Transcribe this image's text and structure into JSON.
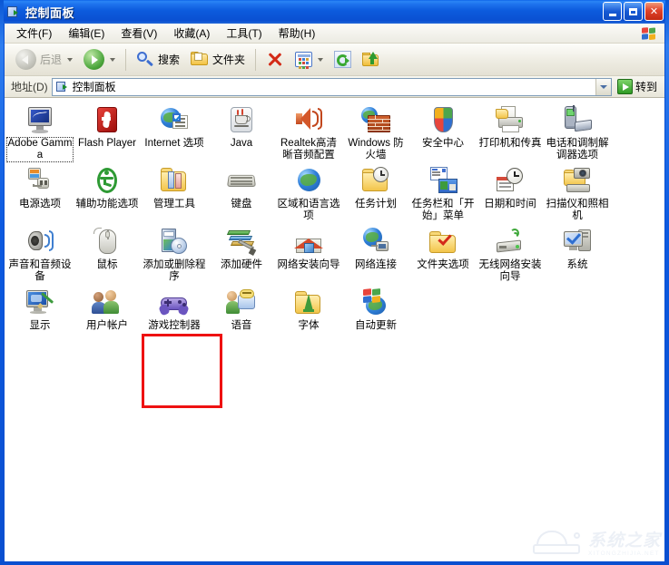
{
  "window": {
    "title": "控制面板",
    "title_icon": "control-panel-icon",
    "buttons": {
      "minimize": "_",
      "maximize": "□",
      "close": "✕"
    }
  },
  "menubar": {
    "items": [
      {
        "label": "文件(F)"
      },
      {
        "label": "编辑(E)"
      },
      {
        "label": "查看(V)"
      },
      {
        "label": "收藏(A)"
      },
      {
        "label": "工具(T)"
      },
      {
        "label": "帮助(H)"
      }
    ],
    "logo": "windows-flag-icon"
  },
  "toolbar": {
    "back_label": "后退",
    "forward_label": "",
    "search_label": "搜索",
    "folders_label": "文件夹",
    "delete_icon": "delete-x-icon",
    "views_icon": "views-icon",
    "refresh_icon": "refresh-icon",
    "moveto_icon": "move-to-folder-icon"
  },
  "address": {
    "label": "地址(D)",
    "value": "控制面板",
    "go_label": "转到"
  },
  "items": [
    {
      "label": "Adobe Gamma",
      "icon": "adobe-gamma-icon",
      "focused": true
    },
    {
      "label": "Flash Player",
      "icon": "flash-player-icon",
      "focused": false
    },
    {
      "label": "Internet 选项",
      "icon": "internet-options-icon",
      "focused": false
    },
    {
      "label": "Java",
      "icon": "java-icon",
      "focused": false
    },
    {
      "label": "Realtek高清晰音频配置",
      "icon": "realtek-audio-icon",
      "focused": false
    },
    {
      "label": "Windows 防火墙",
      "icon": "windows-firewall-icon",
      "focused": false
    },
    {
      "label": "安全中心",
      "icon": "security-center-icon",
      "focused": false
    },
    {
      "label": "打印机和传真",
      "icon": "printers-and-faxes-icon",
      "focused": false
    },
    {
      "label": "电话和调制解调器选项",
      "icon": "phone-and-modem-icon",
      "focused": false
    },
    {
      "label": "电源选项",
      "icon": "power-options-icon",
      "focused": false
    },
    {
      "label": "辅助功能选项",
      "icon": "accessibility-options-icon",
      "focused": false
    },
    {
      "label": "管理工具",
      "icon": "administrative-tools-icon",
      "focused": false
    },
    {
      "label": "键盘",
      "icon": "keyboard-icon",
      "focused": false
    },
    {
      "label": "区域和语言选项",
      "icon": "regional-language-icon",
      "focused": false
    },
    {
      "label": "任务计划",
      "icon": "scheduled-tasks-icon",
      "focused": false
    },
    {
      "label": "任务栏和「开始」菜单",
      "icon": "taskbar-start-menu-icon",
      "focused": false
    },
    {
      "label": "日期和时间",
      "icon": "date-and-time-icon",
      "focused": false
    },
    {
      "label": "扫描仪和照相机",
      "icon": "scanners-cameras-icon",
      "focused": false
    },
    {
      "label": "声音和音频设备",
      "icon": "sounds-audio-devices-icon",
      "focused": false
    },
    {
      "label": "鼠标",
      "icon": "mouse-icon",
      "focused": false
    },
    {
      "label": "添加或删除程序",
      "icon": "add-remove-programs-icon",
      "focused": false,
      "highlighted": true
    },
    {
      "label": "添加硬件",
      "icon": "add-hardware-icon",
      "focused": false
    },
    {
      "label": "网络安装向导",
      "icon": "network-setup-wizard-icon",
      "focused": false
    },
    {
      "label": "网络连接",
      "icon": "network-connections-icon",
      "focused": false
    },
    {
      "label": "文件夹选项",
      "icon": "folder-options-icon",
      "focused": false
    },
    {
      "label": "无线网络安装向导",
      "icon": "wireless-network-wizard-icon",
      "focused": false
    },
    {
      "label": "系统",
      "icon": "system-icon",
      "focused": false
    },
    {
      "label": "显示",
      "icon": "display-icon",
      "focused": false
    },
    {
      "label": "用户帐户",
      "icon": "user-accounts-icon",
      "focused": false
    },
    {
      "label": "游戏控制器",
      "icon": "game-controllers-icon",
      "focused": false
    },
    {
      "label": "语音",
      "icon": "speech-icon",
      "focused": false
    },
    {
      "label": "字体",
      "icon": "fonts-icon",
      "focused": false
    },
    {
      "label": "自动更新",
      "icon": "automatic-updates-icon",
      "focused": false
    }
  ],
  "watermark": {
    "cn": "系统之家",
    "en": "XITONGZHIJIA.NET"
  },
  "colors": {
    "highlight": "#ee1111",
    "titlebar": "#0c5bdd",
    "content_bg": "#ffffff"
  }
}
